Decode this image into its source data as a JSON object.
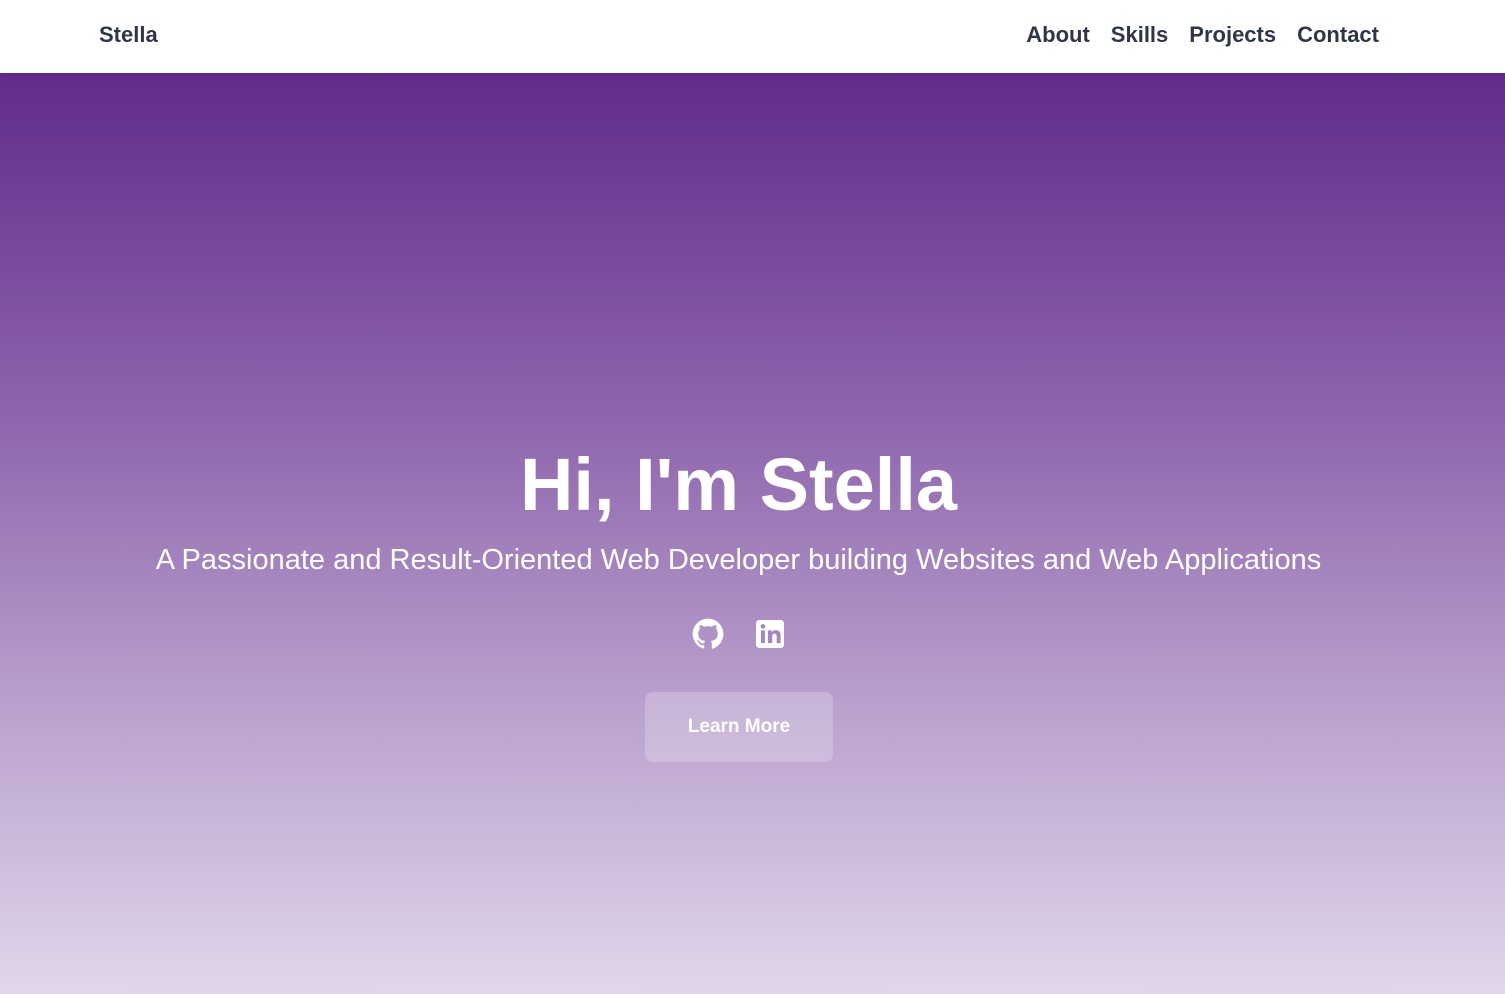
{
  "nav": {
    "brand": "Stella",
    "links": [
      {
        "label": "About"
      },
      {
        "label": "Skills"
      },
      {
        "label": "Projects"
      },
      {
        "label": "Contact"
      }
    ]
  },
  "hero": {
    "title": "Hi, I'm Stella",
    "subtitle": "A Passionate and Result-Oriented Web Developer building Websites and Web Applications",
    "socials": [
      {
        "icon": "github-icon"
      },
      {
        "icon": "linkedin-icon"
      }
    ],
    "cta_label": "Learn More"
  },
  "colors": {
    "nav_text": "#2d3748",
    "hero_gradient_top": "#612b8c",
    "hero_gradient_bottom": "#e2d6ea",
    "hero_text": "#ffffff"
  }
}
